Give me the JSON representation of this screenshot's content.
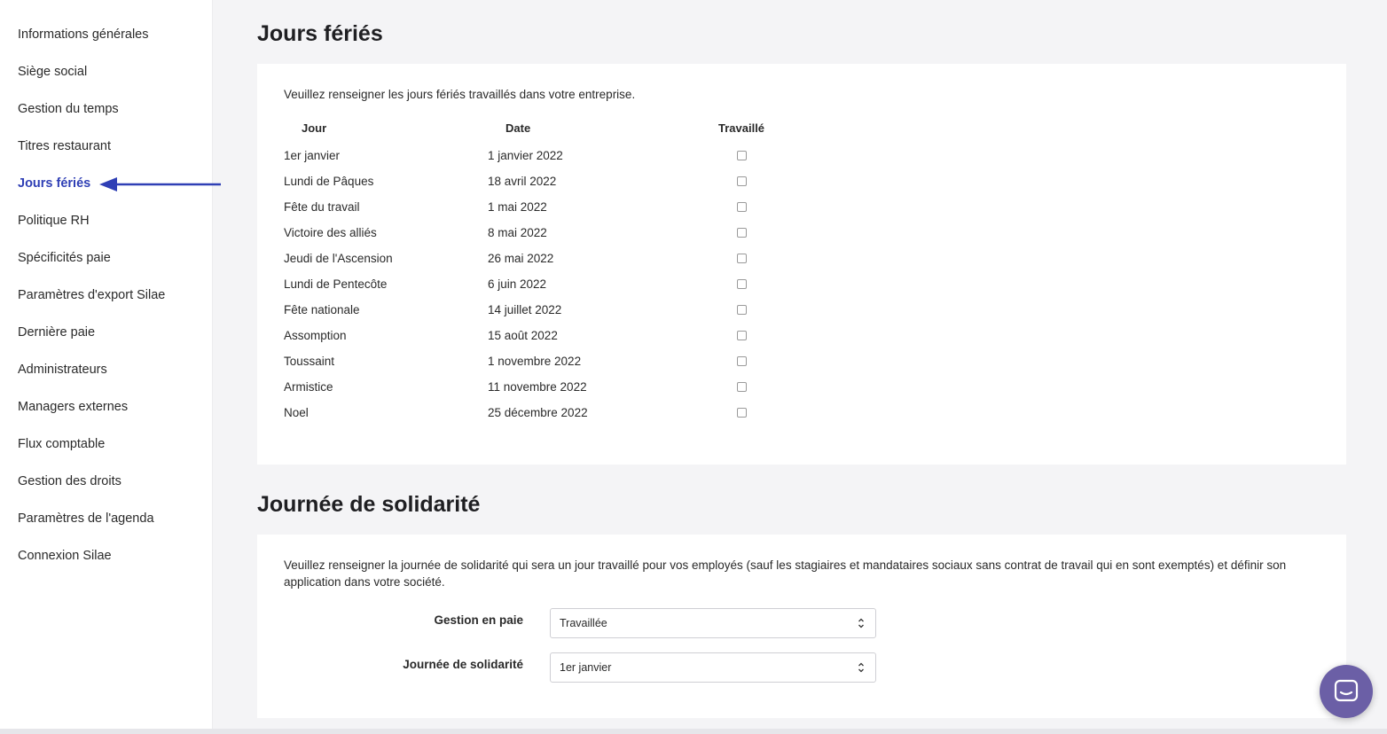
{
  "sidebar": {
    "items": [
      {
        "label": "Informations générales"
      },
      {
        "label": "Siège social"
      },
      {
        "label": "Gestion du temps"
      },
      {
        "label": "Titres restaurant"
      },
      {
        "label": "Jours fériés",
        "active": true
      },
      {
        "label": "Politique RH"
      },
      {
        "label": "Spécificités paie"
      },
      {
        "label": "Paramètres d'export Silae"
      },
      {
        "label": "Dernière paie"
      },
      {
        "label": "Administrateurs"
      },
      {
        "label": "Managers externes"
      },
      {
        "label": "Flux comptable"
      },
      {
        "label": "Gestion des droits"
      },
      {
        "label": "Paramètres de l'agenda"
      },
      {
        "label": "Connexion Silae"
      }
    ],
    "active_color": "#2f3fb5"
  },
  "holidays": {
    "title": "Jours fériés",
    "intro": "Veuillez renseigner les jours fériés travaillés dans votre entreprise.",
    "columns": {
      "jour": "Jour",
      "date": "Date",
      "travaille": "Travaillé"
    },
    "rows": [
      {
        "jour": "1er janvier",
        "date": "1 janvier 2022",
        "worked": false
      },
      {
        "jour": "Lundi de Pâques",
        "date": "18 avril 2022",
        "worked": false
      },
      {
        "jour": "Fête du travail",
        "date": "1 mai 2022",
        "worked": false
      },
      {
        "jour": "Victoire des alliés",
        "date": "8 mai 2022",
        "worked": false
      },
      {
        "jour": "Jeudi de l'Ascension",
        "date": "26 mai 2022",
        "worked": false
      },
      {
        "jour": "Lundi de Pentecôte",
        "date": "6 juin 2022",
        "worked": false
      },
      {
        "jour": "Fête nationale",
        "date": "14 juillet 2022",
        "worked": false
      },
      {
        "jour": "Assomption",
        "date": "15 août 2022",
        "worked": false
      },
      {
        "jour": "Toussaint",
        "date": "1 novembre 2022",
        "worked": false
      },
      {
        "jour": "Armistice",
        "date": "11 novembre 2022",
        "worked": false
      },
      {
        "jour": "Noel",
        "date": "25 décembre 2022",
        "worked": false
      }
    ]
  },
  "solidarity": {
    "title": "Journée de solidarité",
    "intro": "Veuillez renseigner la journée de solidarité qui sera un jour travaillé pour vos employés (sauf les stagiaires et mandataires sociaux sans contrat de travail qui en sont exemptés) et définir son application dans votre société.",
    "gestion_label": "Gestion en paie",
    "gestion_value": "Travaillée",
    "journee_label": "Journée de solidarité",
    "journee_value": "1er janvier"
  },
  "icons": {
    "arrow": "arrow-left-icon",
    "caret": "select-caret-icon",
    "chat": "chat-icon"
  },
  "colors": {
    "annotation_arrow": "#2f3fb5",
    "chat_launcher": "#6b5fa6"
  }
}
